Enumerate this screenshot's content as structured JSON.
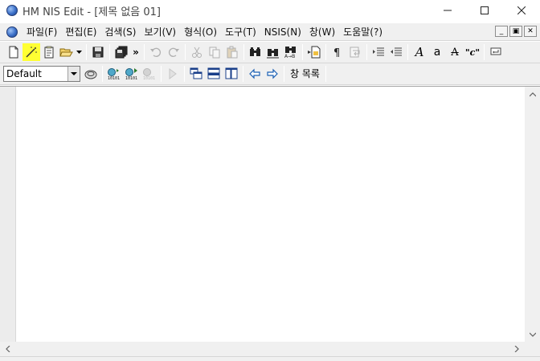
{
  "window": {
    "title": "HM NIS Edit - [제목 없음 01]"
  },
  "menu": {
    "items": [
      {
        "label": "파일(F)"
      },
      {
        "label": "편집(E)"
      },
      {
        "label": "검색(S)"
      },
      {
        "label": "보기(V)"
      },
      {
        "label": "형식(O)"
      },
      {
        "label": "도구(T)"
      },
      {
        "label": "NSIS(N)"
      },
      {
        "label": "창(W)"
      },
      {
        "label": "도움말(?)"
      }
    ],
    "mdi_minimize": "_",
    "mdi_restore": "▣",
    "mdi_close": "✕"
  },
  "toolbar": {
    "overflow": "»",
    "text_a_italic": "A",
    "text_a_lower": "a",
    "text_a_strike": "A",
    "text_quote_c": "\"c\""
  },
  "toolbar2": {
    "style_combo_value": "Default",
    "window_list_label": "창 목록"
  },
  "icons": {
    "accent_highlight": "#ffff33",
    "brand_blue": "#3a6fc8"
  }
}
